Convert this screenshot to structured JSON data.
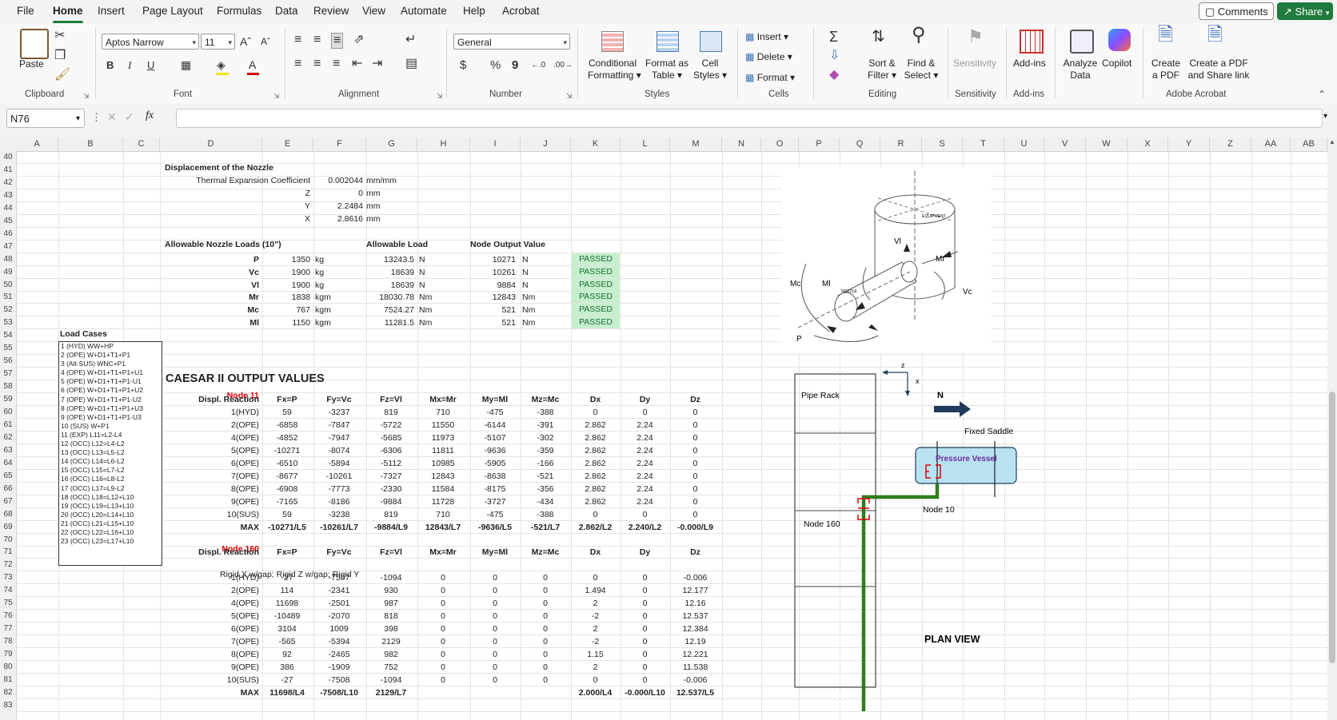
{
  "menu": {
    "tabs": [
      "File",
      "Home",
      "Insert",
      "Page Layout",
      "Formulas",
      "Data",
      "Review",
      "View",
      "Automate",
      "Help",
      "Acrobat"
    ],
    "active": "Home",
    "comments_label": "Comments",
    "share_label": "Share"
  },
  "ribbon": {
    "clipboard": {
      "label": "Clipboard",
      "paste": "Paste"
    },
    "font": {
      "label": "Font",
      "font_name": "Aptos Narrow",
      "font_size": "11",
      "bold": "B",
      "italic": "I",
      "underline": "U"
    },
    "alignment": {
      "label": "Alignment"
    },
    "number": {
      "label": "Number",
      "format": "General",
      "currency": "$",
      "percent": "%",
      "comma": "9"
    },
    "styles": {
      "label": "Styles",
      "conditional": [
        "Conditional",
        "Formatting"
      ],
      "format_table": [
        "Format as",
        "Table"
      ],
      "cell_styles": [
        "Cell",
        "Styles"
      ]
    },
    "cells": {
      "label": "Cells",
      "insert": "Insert",
      "delete": "Delete",
      "format": "Format"
    },
    "editing": {
      "label": "Editing",
      "sort": [
        "Sort &",
        "Filter"
      ],
      "find": [
        "Find &",
        "Select"
      ]
    },
    "sensitivity": {
      "label": "Sensitivity",
      "btn": "Sensitivity"
    },
    "addins": {
      "label": "Add-ins",
      "btn": "Add-ins"
    },
    "analyze": [
      "Analyze",
      "Data"
    ],
    "copilot": "Copilot",
    "acrobat": {
      "label": "Adobe Acrobat",
      "create": [
        "Create",
        "a PDF"
      ],
      "share": [
        "Create a PDF",
        "and Share link"
      ]
    }
  },
  "formula_bar": {
    "name_box": "N76",
    "fx": "fx",
    "value": ""
  },
  "columns": [
    "A",
    "B",
    "C",
    "D",
    "E",
    "F",
    "G",
    "H",
    "I",
    "J",
    "K",
    "L",
    "M",
    "N",
    "O",
    "P",
    "Q",
    "R",
    "S",
    "T",
    "U",
    "V",
    "W",
    "X",
    "Y",
    "Z",
    "AA",
    "AB"
  ],
  "rows": [
    "40",
    "41",
    "42",
    "43",
    "44",
    "45",
    "46",
    "47",
    "48",
    "49",
    "50",
    "51",
    "52",
    "53",
    "54",
    "55",
    "56",
    "57",
    "58",
    "59",
    "60",
    "61",
    "62",
    "63",
    "64",
    "65",
    "66",
    "67",
    "68",
    "69",
    "70",
    "71",
    "72",
    "73",
    "74",
    "75",
    "76",
    "77",
    "78",
    "79",
    "80",
    "81",
    "82",
    "83"
  ],
  "displacement": {
    "title": "Displacement of the Nozzle",
    "rows": [
      {
        "label": "Thermal Expansion Coefficient",
        "value": "0.002044",
        "unit": "mm/mm"
      },
      {
        "label": "Z",
        "value": "0",
        "unit": "mm"
      },
      {
        "label": "Y",
        "value": "2.2484",
        "unit": "mm"
      },
      {
        "label": "X",
        "value": "2.8616",
        "unit": "mm"
      }
    ]
  },
  "allowable": {
    "title": "Allowable Nozzle Loads (10\")",
    "h_allow": "Allowable Load",
    "h_node": "Node Output Value",
    "rows": [
      {
        "name": "P",
        "v1": "1350",
        "u1": "kg",
        "v2": "13243.5",
        "u2": "N",
        "v3": "10271",
        "u3": "N",
        "status": "PASSED"
      },
      {
        "name": "Vc",
        "v1": "1900",
        "u1": "kg",
        "v2": "18639",
        "u2": "N",
        "v3": "10261",
        "u3": "N",
        "status": "PASSED"
      },
      {
        "name": "Vl",
        "v1": "1900",
        "u1": "kg",
        "v2": "18639",
        "u2": "N",
        "v3": "9884",
        "u3": "N",
        "status": "PASSED"
      },
      {
        "name": "Mr",
        "v1": "1838",
        "u1": "kgm",
        "v2": "18030.78",
        "u2": "Nm",
        "v3": "12843",
        "u3": "Nm",
        "status": "PASSED"
      },
      {
        "name": "Mc",
        "v1": "767",
        "u1": "kgm",
        "v2": "7524.27",
        "u2": "Nm",
        "v3": "521",
        "u3": "Nm",
        "status": "PASSED"
      },
      {
        "name": "Ml",
        "v1": "1150",
        "u1": "kgm",
        "v2": "11281.5",
        "u2": "Nm",
        "v3": "521",
        "u3": "Nm",
        "status": "PASSED"
      }
    ]
  },
  "load_cases": {
    "title": "Load Cases",
    "items": [
      "1 (HYD) WW+HP",
      "2 (OPE) W+D1+T1+P1",
      "3 (Alt-SUS) WNC+P1",
      "4 (OPE) W+D1+T1+P1+U1",
      "5 (OPE) W+D1+T1+P1-U1",
      "6 (OPE) W+D1+T1+P1+U2",
      "7 (OPE) W+D1+T1+P1-U2",
      "8 (OPE) W+D1+T1+P1+U3",
      "9 (OPE) W+D1+T1+P1-U3",
      "10 (SUS) W+P1",
      "11 (EXP) L11=L2-L4",
      "12 (OCC) L12=L4-L2",
      "13 (OCC) L13=L5-L2",
      "14 (OCC) L14=L6-L2",
      "15 (OCC) L15=L7-L2",
      "16 (OCC) L16=L8-L2",
      "17 (OCC) L17=L9-L2",
      "18 (OCC) L18=L12+L10",
      "19 (OCC) L19=L13+L10",
      "20 (OCC) L20=L14+L10",
      "21 (OCC) L21=L15+L10",
      "22 (OCC) L22=L16+L10",
      "23 (OCC) L23=L17+L10"
    ]
  },
  "caesar": {
    "title": "CAESAR II OUTPUT VALUES",
    "headers": [
      "Displ. Reaction",
      "Fx=P",
      "Fy=Vc",
      "Fz=Vl",
      "Mx=Mr",
      "My=Ml",
      "Mz=Mc",
      "Dx",
      "Dy",
      "Dz"
    ],
    "node11": {
      "label": "Node 11",
      "rows": [
        [
          "1(HYD)",
          "59",
          "-3237",
          "819",
          "710",
          "-475",
          "-388",
          "0",
          "0",
          "0"
        ],
        [
          "2(OPE)",
          "-6858",
          "-7847",
          "-5722",
          "11550",
          "-6144",
          "-391",
          "2.862",
          "2.24",
          "0"
        ],
        [
          "4(OPE)",
          "-4852",
          "-7947",
          "-5685",
          "11973",
          "-5107",
          "-302",
          "2.862",
          "2.24",
          "0"
        ],
        [
          "5(OPE)",
          "-10271",
          "-8074",
          "-6306",
          "11811",
          "-9636",
          "-359",
          "2.862",
          "2.24",
          "0"
        ],
        [
          "6(OPE)",
          "-6510",
          "-5894",
          "-5112",
          "10985",
          "-5905",
          "-166",
          "2.862",
          "2.24",
          "0"
        ],
        [
          "7(OPE)",
          "-8677",
          "-10261",
          "-7327",
          "12843",
          "-8638",
          "-521",
          "2.862",
          "2.24",
          "0"
        ],
        [
          "8(OPE)",
          "-6908",
          "-7773",
          "-2330",
          "11584",
          "-8175",
          "-356",
          "2.862",
          "2.24",
          "0"
        ],
        [
          "9(OPE)",
          "-7165",
          "-8186",
          "-9884",
          "11728",
          "-3727",
          "-434",
          "2.862",
          "2.24",
          "0"
        ],
        [
          "10(SUS)",
          "59",
          "-3238",
          "819",
          "710",
          "-475",
          "-388",
          "0",
          "0",
          "0"
        ]
      ],
      "max": [
        "MAX",
        "-10271/L5",
        "-10261/L7",
        "-9884/L9",
        "12843/L7",
        "-9636/L5",
        "-521/L7",
        "2.862/L2",
        "2.240/L2",
        "-0.000/L9"
      ]
    },
    "node160": {
      "label": "Node 160",
      "note": "Rigid X w/gap; Rigid Z w/gap; Rigid Y",
      "rows": [
        [
          "1(HYD)",
          "-27",
          "-7507",
          "-1094",
          "0",
          "0",
          "0",
          "0",
          "0",
          "-0.006"
        ],
        [
          "2(OPE)",
          "114",
          "-2341",
          "930",
          "0",
          "0",
          "0",
          "1.494",
          "0",
          "12.177"
        ],
        [
          "4(OPE)",
          "11698",
          "-2501",
          "987",
          "0",
          "0",
          "0",
          "2",
          "0",
          "12.16"
        ],
        [
          "5(OPE)",
          "-10489",
          "-2070",
          "818",
          "0",
          "0",
          "0",
          "-2",
          "0",
          "12.537"
        ],
        [
          "6(OPE)",
          "3104",
          "1009",
          "398",
          "0",
          "0",
          "0",
          "2",
          "0",
          "12.384"
        ],
        [
          "7(OPE)",
          "-565",
          "-5394",
          "2129",
          "0",
          "0",
          "0",
          "-2",
          "0",
          "12.19"
        ],
        [
          "8(OPE)",
          "92",
          "-2465",
          "982",
          "0",
          "0",
          "0",
          "1.15",
          "0",
          "12.221"
        ],
        [
          "9(OPE)",
          "386",
          "-1909",
          "752",
          "0",
          "0",
          "0",
          "2",
          "0",
          "11.538"
        ],
        [
          "10(SUS)",
          "-27",
          "-7508",
          "-1094",
          "0",
          "0",
          "0",
          "0",
          "0",
          "-0.006"
        ]
      ],
      "max": [
        "MAX",
        "11698/L4",
        "-7508/L10",
        "2129/L7",
        "",
        "",
        "",
        "2.000/L4",
        "-0.000/L10",
        "12.537/L5"
      ]
    }
  },
  "nozzle_figure": {
    "labels": {
      "mc": "Mc",
      "ml": "Ml",
      "vl": "Vl",
      "mr": "Mr",
      "vc": "Vc",
      "p": "P",
      "equipment": "EQUIPMENT",
      "nozzle": "NOZZLE"
    }
  },
  "plan_view": {
    "title": "PLAN VIEW",
    "pipe_rack": "Pipe Rack",
    "node160": "Node 160",
    "node10": "Node 10",
    "fixed_saddle": "Fixed Saddle",
    "vessel": "Pressure Vessel",
    "north": "N",
    "z": "z",
    "x": "x",
    "colors": {
      "pipe": "#2e7d1e",
      "vessel_fill": "#b8e2f2",
      "vessel_text": "#6a2fa0",
      "arrow": "#1f3c5a",
      "flange": "#e00000"
    }
  }
}
